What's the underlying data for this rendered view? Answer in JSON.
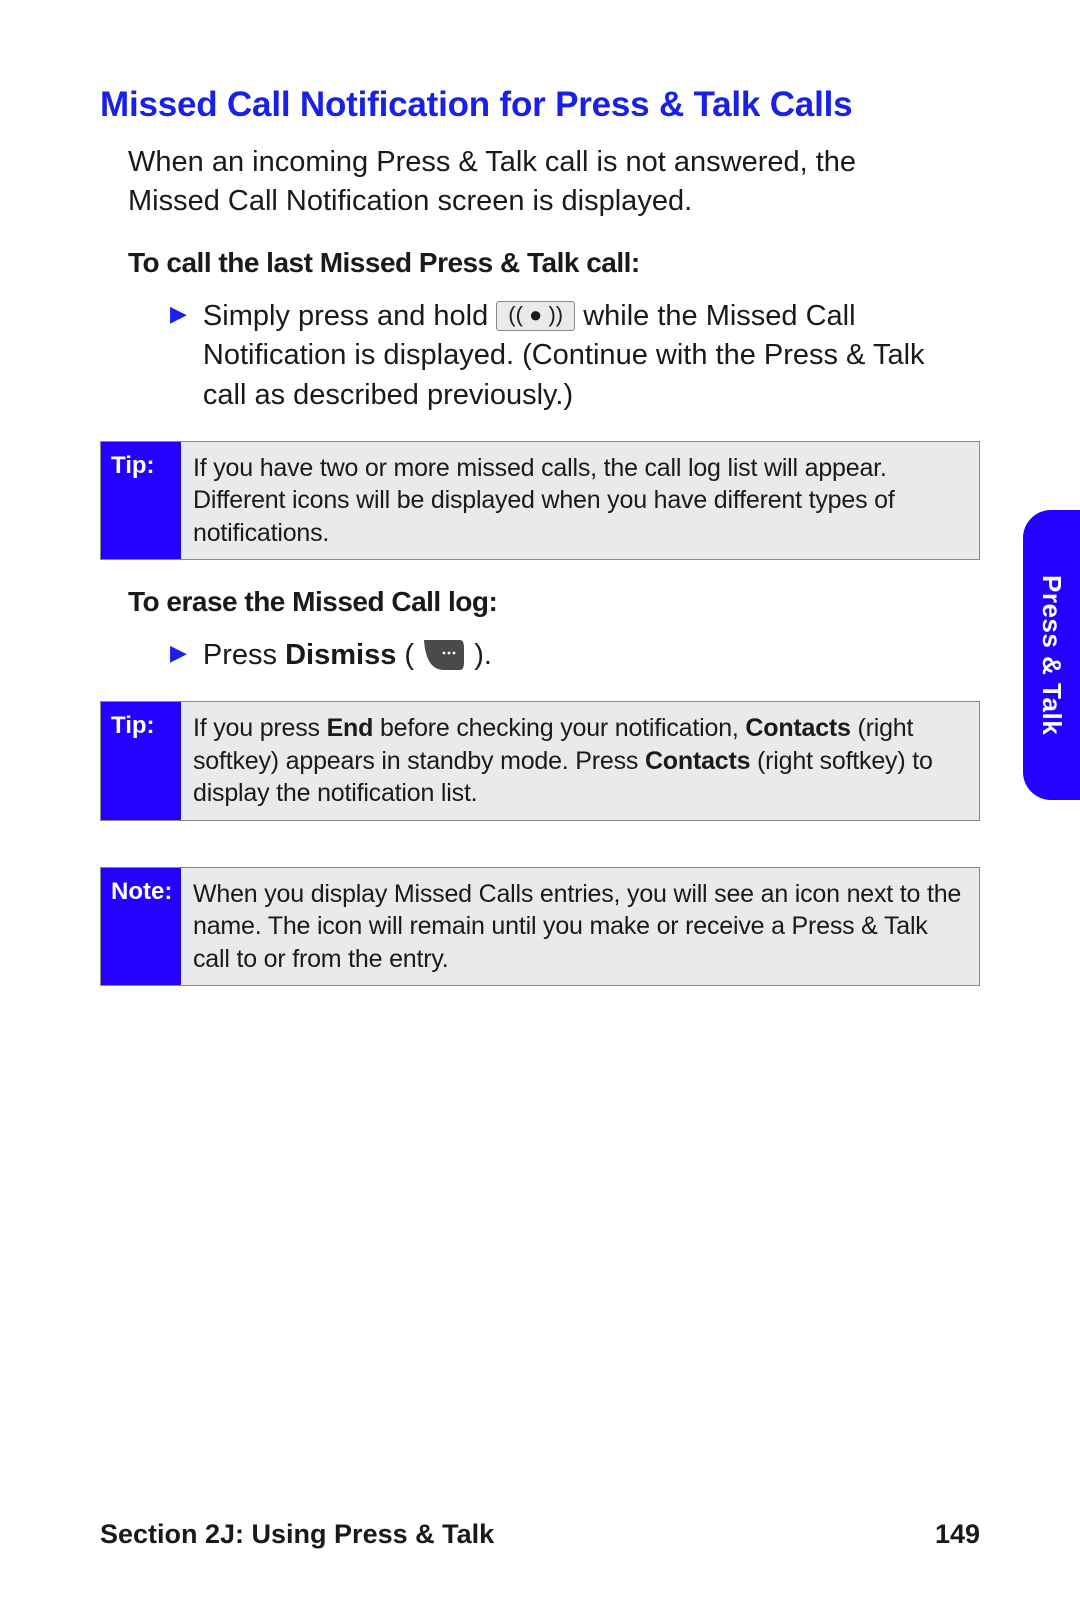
{
  "title": "Missed Call Notification for Press & Talk Calls",
  "intro": "When an incoming Press & Talk call is not answered, the Missed Call Notification screen is displayed.",
  "sub1": "To call the last Missed Press & Talk call:",
  "bullet1_a": "Simply press and hold ",
  "ptt_label": "(( ● ))",
  "bullet1_b": " while the Missed Call Notification is displayed. (Continue with the Press & Talk call as described previously.)",
  "tip_label": "Tip:",
  "note_label": "Note:",
  "tip1": "If you have two or more missed calls, the call log list will appear. Different icons will be displayed when you have different types of notifications.",
  "sub2": "To erase the Missed Call log:",
  "bullet2_a": "Press ",
  "bullet2_bold": "Dismiss",
  "bullet2_b": " (",
  "bullet2_c": ").",
  "tip2_a": "If you press ",
  "tip2_b1": "End",
  "tip2_c": " before checking your notification, ",
  "tip2_b2": "Contacts",
  "tip2_d": " (right softkey) appears in standby mode. Press ",
  "tip2_b3": "Contacts",
  "tip2_e": " (right softkey) to display the notification list.",
  "note1": "When you display Missed Calls entries, you will see an icon next to the name. The icon will remain until you make or receive a Press & Talk call to or from the entry.",
  "side_tab": "Press & Talk",
  "footer_section": "Section 2J: Using Press & Talk",
  "footer_page": "149"
}
